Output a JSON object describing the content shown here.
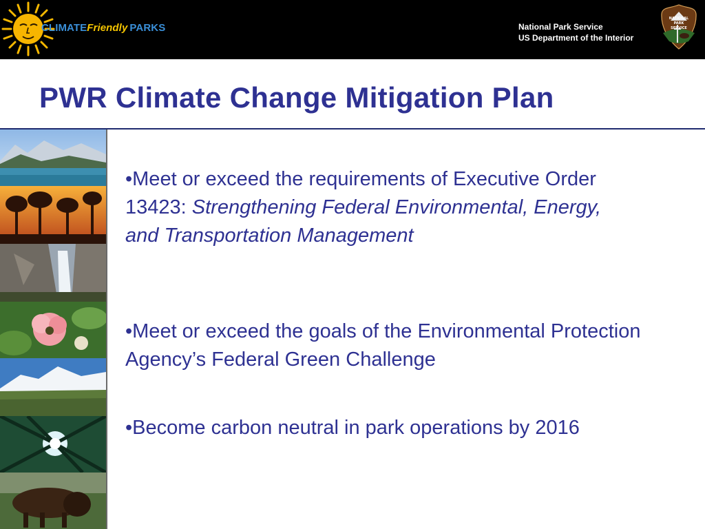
{
  "header": {
    "brand": {
      "part1": "CLIMATE",
      "part2": "Friendly",
      "part3": "PARKS"
    },
    "agency_line1": "National Park Service",
    "agency_line2": "US Department of the Interior",
    "badge_text": {
      "line1": "NATIONAL",
      "line2": "PARK",
      "line3": "SERVICE"
    }
  },
  "slide": {
    "title": "PWR Climate Change Mitigation Plan",
    "bullets": [
      {
        "prefix": "•Meet or exceed the requirements of Executive Order 13423:  ",
        "emphasis": "Strengthening Federal Environmental, Energy, and Transportation Management"
      },
      {
        "text": "•Meet or exceed the goals of the Environmental Protection Agency’s  Federal Green Challenge"
      },
      {
        "text": "•Become carbon neutral in park operations by 2016"
      }
    ]
  },
  "colors": {
    "title_blue": "#2e3192",
    "banner_black": "#000000",
    "brand_blue": "#3a8fd8",
    "brand_yellow": "#f4c400"
  },
  "icons": {
    "logo": "sun-face-icon",
    "badge": "arrowhead-emblem-icon"
  }
}
